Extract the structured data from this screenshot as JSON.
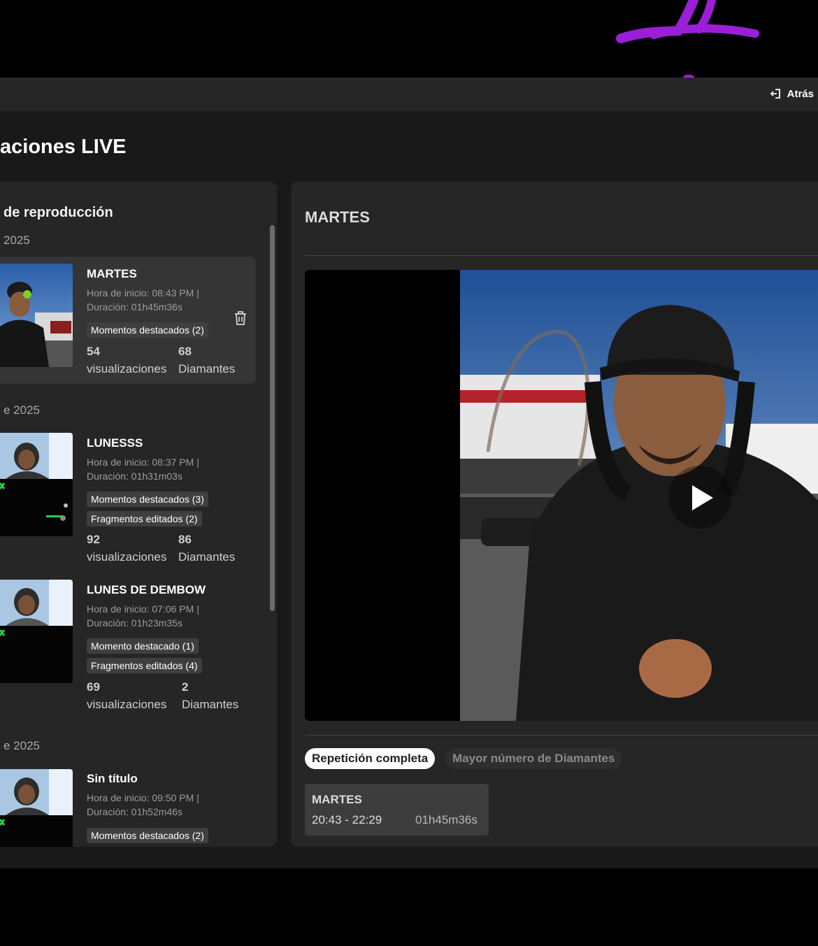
{
  "header": {
    "back_label": "Atrás"
  },
  "page": {
    "title": "aciones LIVE"
  },
  "sidebar": {
    "title": "de reproducción",
    "groups": [
      {
        "date": "2025"
      },
      {
        "date": "e 2025"
      },
      {
        "date": "e 2025"
      }
    ],
    "sessions": [
      {
        "title": "MARTES",
        "start": "Hora de inicio: 08:43 PM |",
        "duration": "Duración: 01h45m36s",
        "tags": [
          "Momentos destacados (2)"
        ],
        "views": "54",
        "views_label": "visualizaciones",
        "diamonds": "68",
        "diamonds_label": "Diamantes"
      },
      {
        "title": "LUNESSS",
        "start": "Hora de inicio: 08:37 PM |",
        "duration": "Duración: 01h31m03s",
        "tags": [
          "Momentos destacados (3)",
          "Fragmentos editados (2)"
        ],
        "views": "92",
        "views_label": "visualizaciones",
        "diamonds": "86",
        "diamonds_label": "Diamantes"
      },
      {
        "title": "LUNES DE DEMBOW",
        "start": "Hora de inicio: 07:06 PM |",
        "duration": "Duración: 01h23m35s",
        "tags": [
          "Momento destacado (1)",
          "Fragmentos editados (4)"
        ],
        "views": "69",
        "views_label": "visualizaciones",
        "diamonds": "2",
        "diamonds_label": "Diamantes"
      },
      {
        "title": "Sin título",
        "start": "Hora de inicio: 09:50 PM |",
        "duration": "Duración: 01h52m46s",
        "tags": [
          "Momentos destacados (2)"
        ]
      }
    ]
  },
  "player": {
    "title": "MARTES",
    "tabs": [
      "Repetición completa",
      "Mayor número de Diamantes"
    ],
    "clip": {
      "title": "MARTES",
      "time": "20:43 - 22:29",
      "duration": "01h45m36s"
    }
  },
  "colors": {
    "accent": "#9b1fd6",
    "background": "#191919",
    "panel": "#262626"
  }
}
